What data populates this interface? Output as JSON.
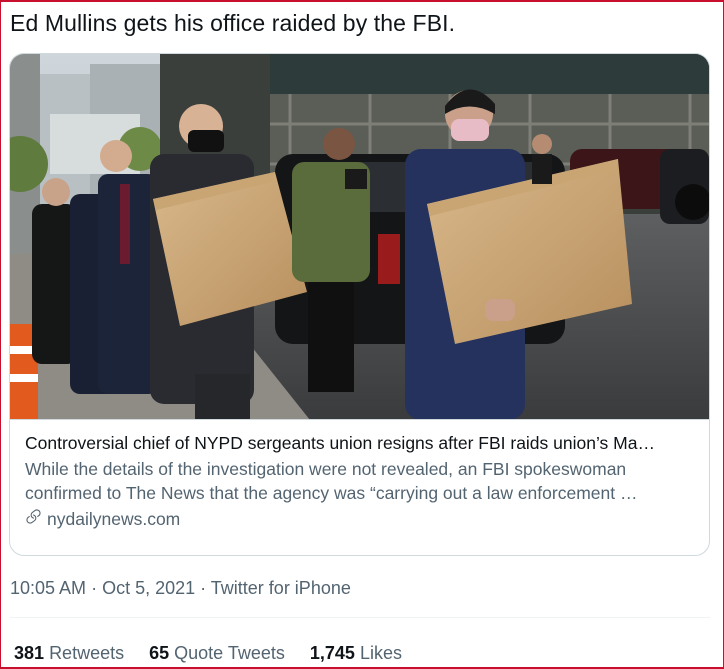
{
  "tweet": {
    "text": "Ed Mullins gets his office raided by the FBI."
  },
  "card": {
    "image_alt": "photo",
    "title": "Controversial chief of NYPD sergeants union resigns after FBI raids union’s Ma…",
    "description_line1": "While the details of the investigation were not revealed, an FBI spokeswoman",
    "description_line2": "confirmed to The News that the agency was “carrying out a law enforcement …",
    "domain": "nydailynews.com",
    "link_icon": "link-icon"
  },
  "meta": {
    "time": "10:05 AM",
    "sep1": " · ",
    "date": "Oct 5, 2021",
    "sep2": " · ",
    "source": "Twitter for iPhone"
  },
  "stats": {
    "retweets_count": "381",
    "retweets_label": "Retweets",
    "quotes_count": "65",
    "quotes_label": "Quote Tweets",
    "likes_count": "1,745",
    "likes_label": "Likes"
  },
  "colors": {
    "text": "#0f1419",
    "secondary": "#536471",
    "border": "#cfd9de",
    "frame": "#c8102e"
  }
}
